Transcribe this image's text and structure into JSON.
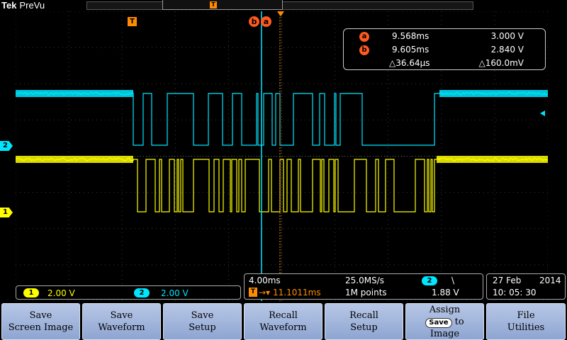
{
  "header": {
    "brand": "Tek",
    "mode": "PreVu"
  },
  "colors": {
    "ch1": "#ffff00",
    "ch2": "#00e6ff",
    "accent": "#ff8c00",
    "cursor": "#ff5a1f",
    "grid": "#3a3a3a"
  },
  "markers": {
    "trigger_marker_label": "T",
    "cursor_b_label": "b",
    "cursor_a_label": "a",
    "ch1_ground_label": "1",
    "ch2_ground_label": "2"
  },
  "cursor_readout": {
    "a": {
      "label": "a",
      "time": "9.568ms",
      "volts": "3.000 V"
    },
    "b": {
      "label": "b",
      "time": "9.605ms",
      "volts": "2.840 V"
    },
    "delta": {
      "time": "△36.64µs",
      "volts": "△160.0mV"
    }
  },
  "channel_status": {
    "ch1": {
      "label": "1",
      "scale": "2.00 V"
    },
    "ch2": {
      "label": "2",
      "scale": "2.00 V"
    }
  },
  "timebase": {
    "scale": "4.00ms",
    "sample_rate": "25.0MS/s",
    "trigger_source": "2",
    "trigger_slope": "\\",
    "trigger_icon": "T",
    "trigger_position": "11.1011ms",
    "record_length": "1M points",
    "trigger_level": "1.88 V"
  },
  "datetime": {
    "date": "27 Feb",
    "year": "2014",
    "time": "10: 05: 30"
  },
  "menu": {
    "save_screen_image": [
      "Save",
      "Screen Image"
    ],
    "save_waveform": [
      "Save",
      "Waveform"
    ],
    "save_setup": [
      "Save",
      "Setup"
    ],
    "recall_waveform": [
      "Recall",
      "Waveform"
    ],
    "recall_setup": [
      "Recall",
      "Setup"
    ],
    "assign_save": {
      "line1": "Assign",
      "pill": "Save",
      "to": "to",
      "line3": "Image"
    },
    "file_utilities": [
      "File",
      "Utilities"
    ]
  }
}
